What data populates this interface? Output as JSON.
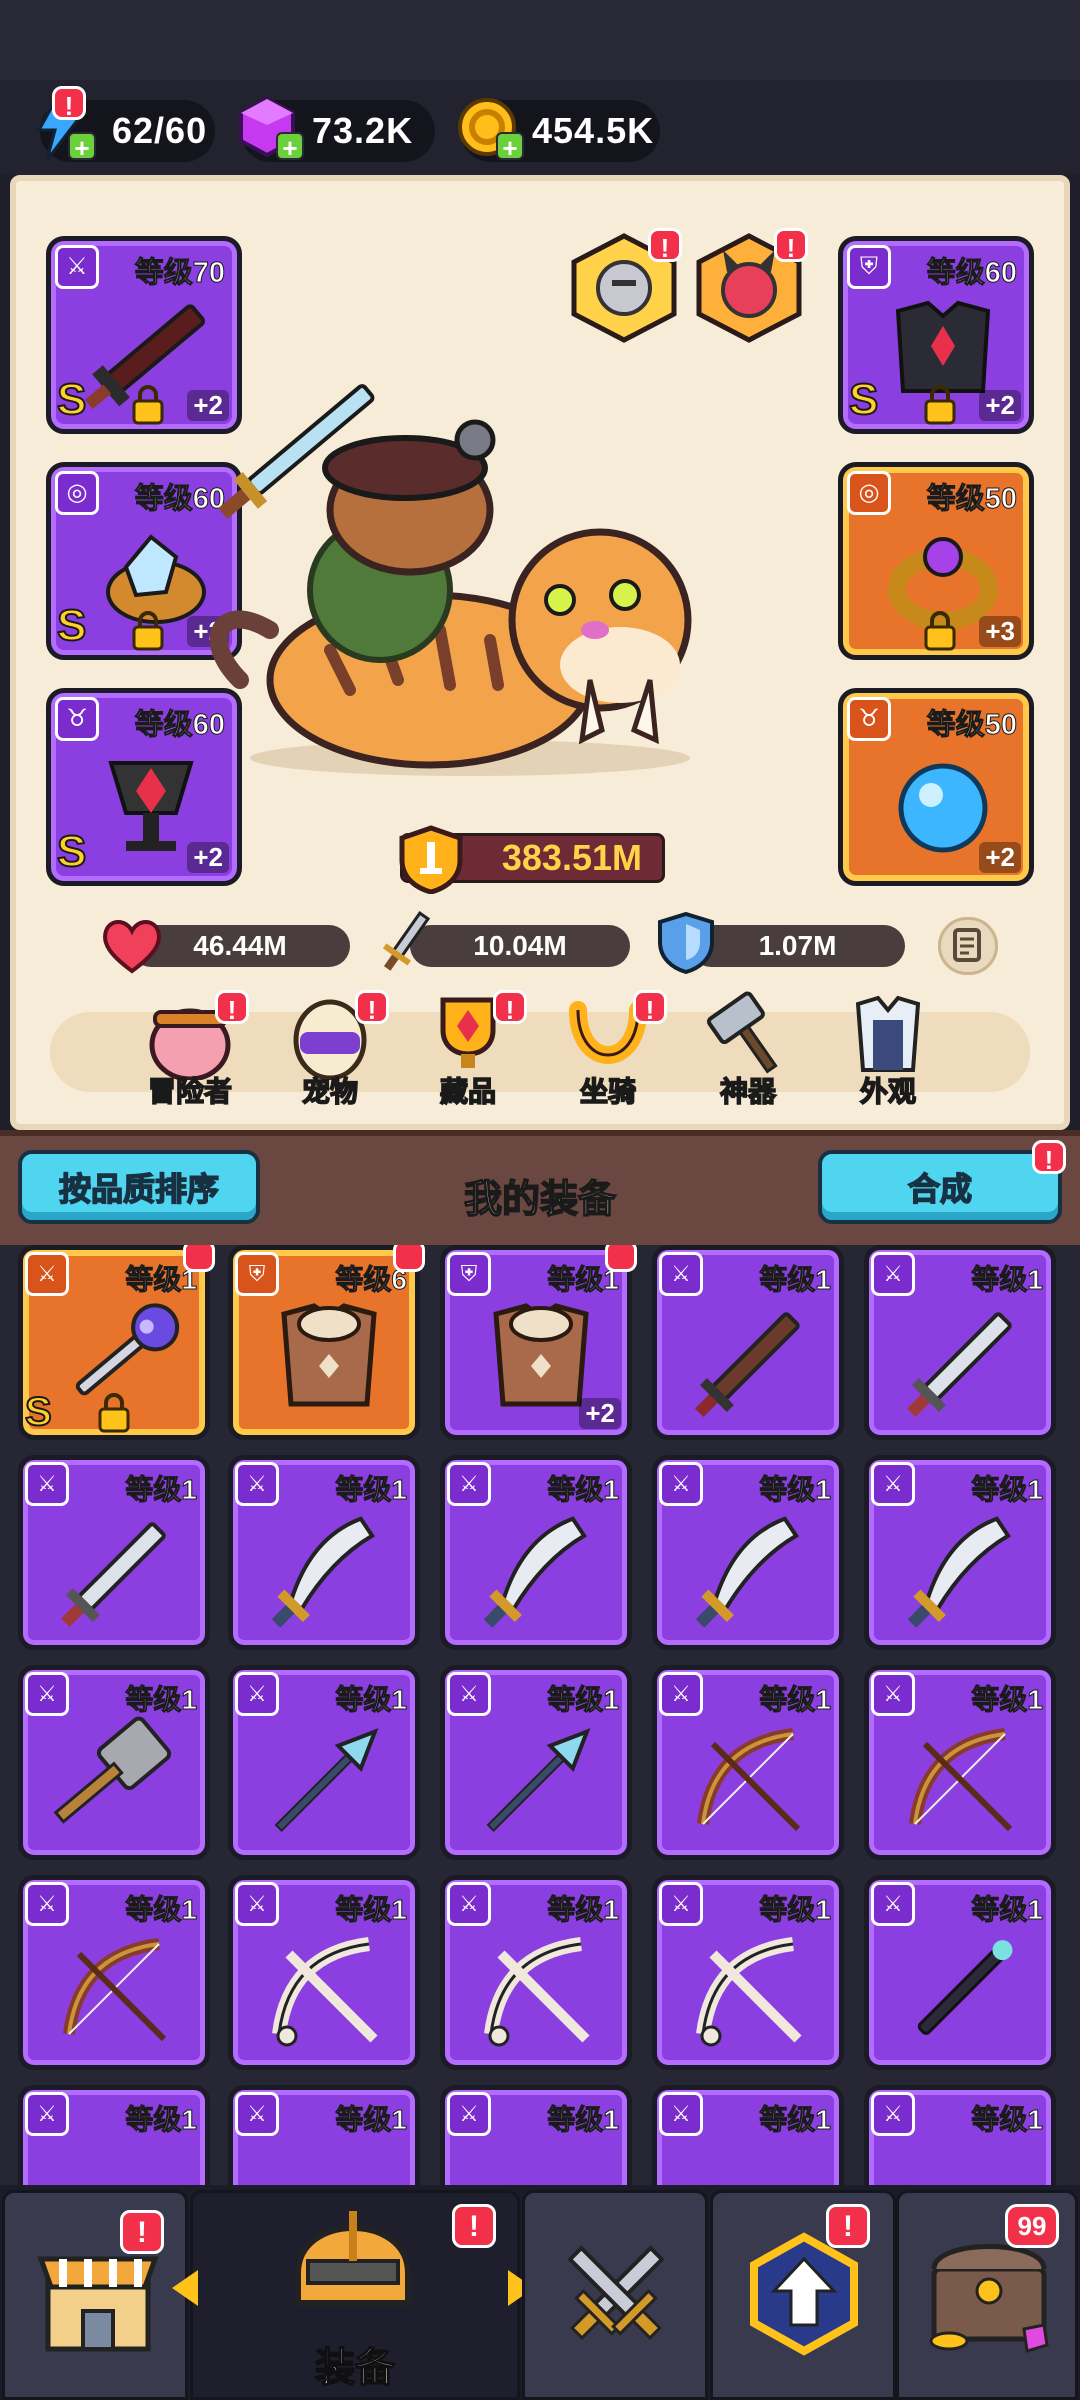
{
  "resources": {
    "energy": "62/60",
    "gems": "73.2K",
    "gold": "454.5K"
  },
  "equipped": {
    "left": [
      {
        "level": "等级70",
        "grade": "S",
        "plus": "+2",
        "item": "dark-sword"
      },
      {
        "level": "等级60",
        "grade": "S",
        "plus": "+2",
        "item": "crystal-ring"
      },
      {
        "level": "等级60",
        "grade": "S",
        "plus": "+2",
        "item": "red-gem-amulet"
      }
    ],
    "right": [
      {
        "level": "等级60",
        "grade": "S",
        "plus": "+2",
        "item": "dark-armor"
      },
      {
        "level": "等级50",
        "grade": "",
        "plus": "+3",
        "item": "gold-ring"
      },
      {
        "level": "等级50",
        "grade": "",
        "plus": "+2",
        "item": "blue-orb"
      }
    ]
  },
  "power": "383.51M",
  "stats": {
    "hp": "46.44M",
    "attack": "10.04M",
    "defense": "1.07M"
  },
  "hero_nav": [
    {
      "label": "冒险者",
      "badge": "!"
    },
    {
      "label": "宠物",
      "badge": "!"
    },
    {
      "label": "藏品",
      "badge": "!"
    },
    {
      "label": "坐骑",
      "badge": "!"
    },
    {
      "label": "神器",
      "badge": ""
    },
    {
      "label": "外观",
      "badge": ""
    }
  ],
  "section": {
    "sort_button": "按品质排序",
    "title": "我的装备",
    "merge_button": "合成"
  },
  "inventory": [
    {
      "level": "等级1",
      "rarity": "orange",
      "item": "staff",
      "grade": "S",
      "new": true,
      "locked": true
    },
    {
      "level": "等级6",
      "rarity": "orange",
      "item": "fur-armor",
      "new": true
    },
    {
      "level": "等级1",
      "rarity": "purple",
      "item": "fur-armor",
      "plus": "+2",
      "new": true
    },
    {
      "level": "等级1",
      "rarity": "purple",
      "item": "wood-sword"
    },
    {
      "level": "等级1",
      "rarity": "purple",
      "item": "steel-sword"
    },
    {
      "level": "等级1",
      "rarity": "purple",
      "item": "steel-sword"
    },
    {
      "level": "等级1",
      "rarity": "purple",
      "item": "scimitar"
    },
    {
      "level": "等级1",
      "rarity": "purple",
      "item": "scimitar"
    },
    {
      "level": "等级1",
      "rarity": "purple",
      "item": "scimitar"
    },
    {
      "level": "等级1",
      "rarity": "purple",
      "item": "scimitar"
    },
    {
      "level": "等级1",
      "rarity": "purple",
      "item": "hammer"
    },
    {
      "level": "等级1",
      "rarity": "purple",
      "item": "spear"
    },
    {
      "level": "等级1",
      "rarity": "purple",
      "item": "spear"
    },
    {
      "level": "等级1",
      "rarity": "purple",
      "item": "bow"
    },
    {
      "level": "等级1",
      "rarity": "purple",
      "item": "bow"
    },
    {
      "level": "等级1",
      "rarity": "purple",
      "item": "bow"
    },
    {
      "level": "等级1",
      "rarity": "purple",
      "item": "bone-bow"
    },
    {
      "level": "等级1",
      "rarity": "purple",
      "item": "bone-bow"
    },
    {
      "level": "等级1",
      "rarity": "purple",
      "item": "bone-bow"
    },
    {
      "level": "等级1",
      "rarity": "purple",
      "item": "wand"
    },
    {
      "level": "等级1",
      "rarity": "purple",
      "item": "misc"
    },
    {
      "level": "等级1",
      "rarity": "purple",
      "item": "misc"
    },
    {
      "level": "等级1",
      "rarity": "purple",
      "item": "misc"
    },
    {
      "level": "等级1",
      "rarity": "purple",
      "item": "misc"
    },
    {
      "level": "等级1",
      "rarity": "purple",
      "item": "misc"
    }
  ],
  "bottom_nav": [
    {
      "label": "",
      "icon": "shop-icon",
      "badge": "!"
    },
    {
      "label": "装备",
      "icon": "helmet-icon",
      "badge": "!",
      "active": true
    },
    {
      "label": "",
      "icon": "crossed-swords-icon",
      "badge": ""
    },
    {
      "label": "",
      "icon": "upgrade-icon",
      "badge": "!"
    },
    {
      "label": "",
      "icon": "chest-icon",
      "badge": "99"
    }
  ],
  "colors": {
    "purple": "#8b3fe0",
    "orange": "#e8732a",
    "accent_cyan": "#4fd5ef",
    "alert_red": "#f2304a"
  }
}
